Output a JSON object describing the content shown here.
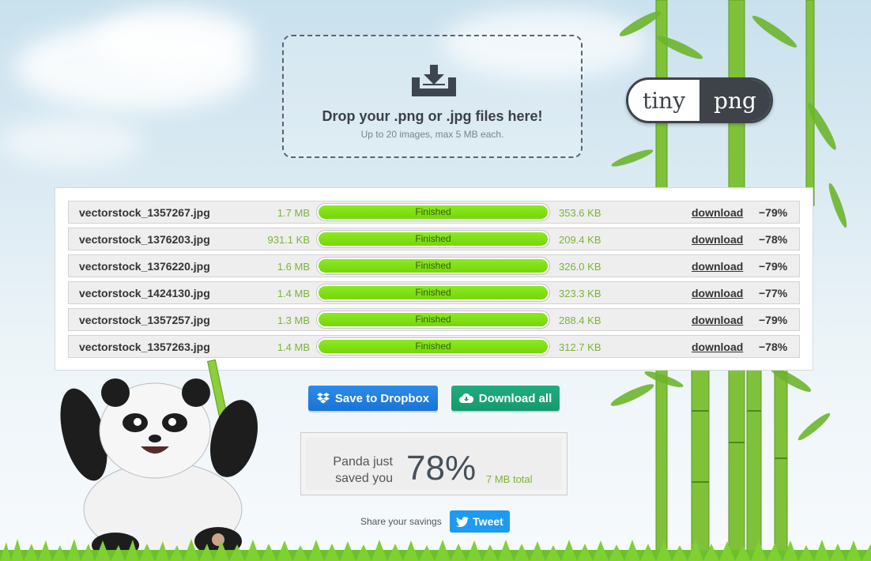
{
  "dropzone": {
    "icon": "download-tray-icon",
    "title": "Drop your .png or .jpg files here!",
    "subtitle": "Up to 20 images, max 5 MB each."
  },
  "logo": {
    "part1": "tiny",
    "part2": "png"
  },
  "files": [
    {
      "name": "vectorstock_1357267.jpg",
      "original": "1.7 MB",
      "status": "Finished",
      "progress": 100,
      "compressed": "353.6 KB",
      "action": "download",
      "saving": "−79%"
    },
    {
      "name": "vectorstock_1376203.jpg",
      "original": "931.1 KB",
      "status": "Finished",
      "progress": 100,
      "compressed": "209.4 KB",
      "action": "download",
      "saving": "−78%"
    },
    {
      "name": "vectorstock_1376220.jpg",
      "original": "1.6 MB",
      "status": "Finished",
      "progress": 100,
      "compressed": "326.0 KB",
      "action": "download",
      "saving": "−79%"
    },
    {
      "name": "vectorstock_1424130.jpg",
      "original": "1.4 MB",
      "status": "Finished",
      "progress": 100,
      "compressed": "323.3 KB",
      "action": "download",
      "saving": "−77%"
    },
    {
      "name": "vectorstock_1357257.jpg",
      "original": "1.3 MB",
      "status": "Finished",
      "progress": 100,
      "compressed": "288.4 KB",
      "action": "download",
      "saving": "−79%"
    },
    {
      "name": "vectorstock_1357263.jpg",
      "original": "1.4 MB",
      "status": "Finished",
      "progress": 100,
      "compressed": "312.7 KB",
      "action": "download",
      "saving": "−78%"
    }
  ],
  "actions": {
    "dropbox_label": "Save to Dropbox",
    "download_all_label": "Download all"
  },
  "savings": {
    "line1": "Panda just",
    "line2": "saved you",
    "percent": "78%",
    "total": "7 MB total"
  },
  "share": {
    "label": "Share your savings",
    "tweet_label": "Tweet"
  },
  "colors": {
    "progress": "#7ee012",
    "dropbox": "#1f7fe0",
    "download_all": "#1aa377",
    "tweet": "#1d9bf0",
    "size_text": "#7ab338"
  }
}
